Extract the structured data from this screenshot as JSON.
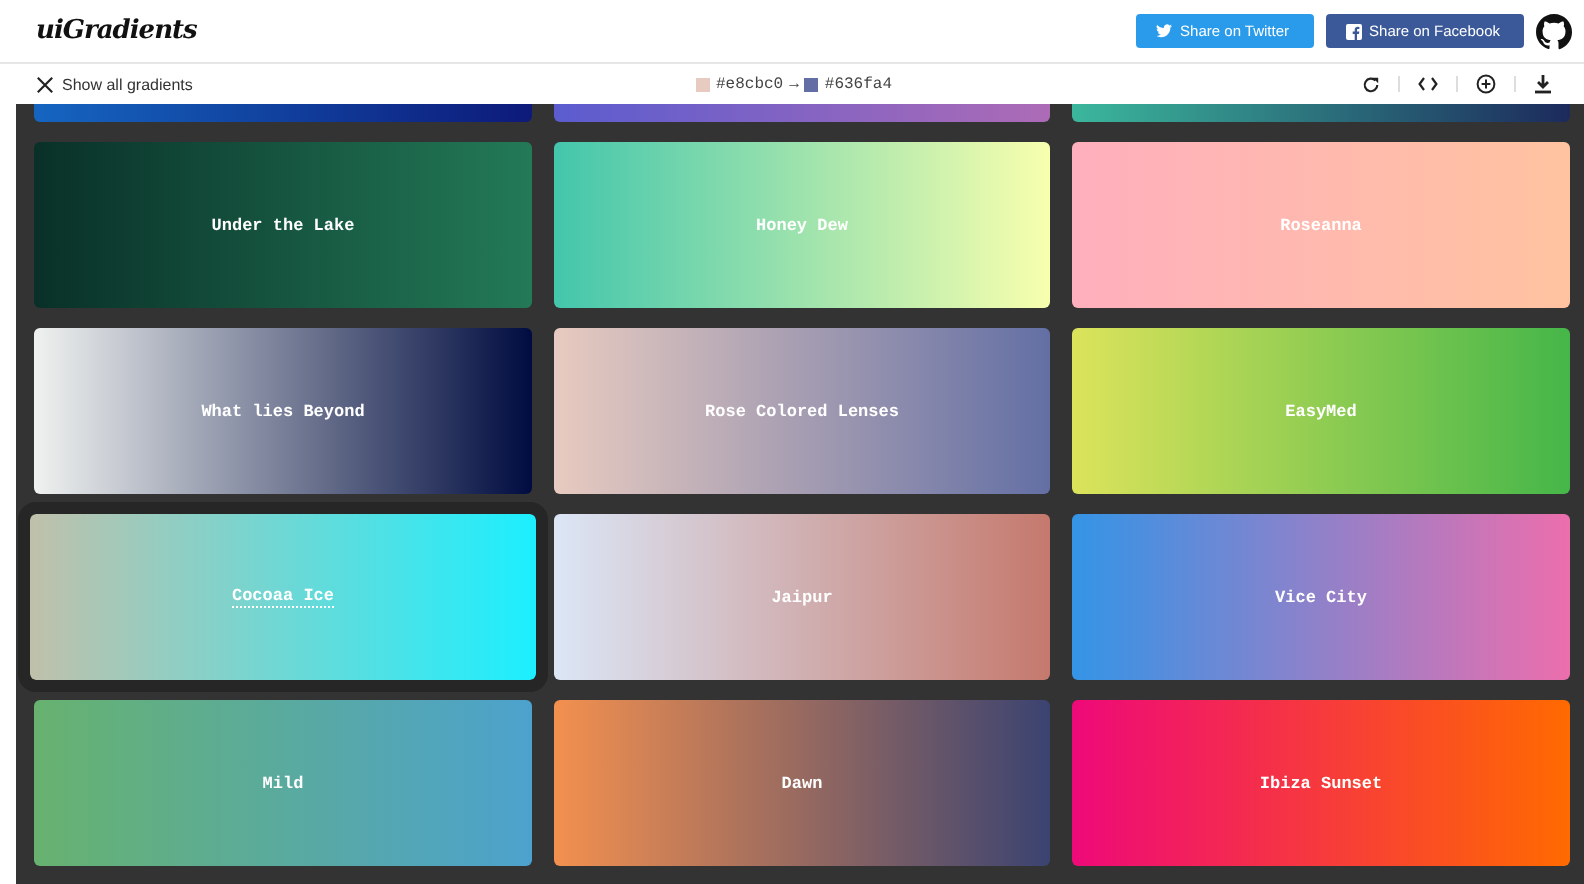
{
  "header": {
    "logo": "uiGradients",
    "buttons": [
      {
        "kind": "twitter",
        "label": "Share on Twitter"
      },
      {
        "kind": "facebook",
        "label": "Share on Facebook"
      }
    ]
  },
  "toolbar": {
    "back": "Show all gradients",
    "from": "#e8cbc0",
    "arrow": "→",
    "to": "#636fa4"
  },
  "cards": [
    {
      "cut": true,
      "stops": [
        {
          "color": "#1565c0"
        },
        {
          "color": "#0d1a7a"
        }
      ],
      "selected": false
    },
    {
      "cut": true,
      "stops": [
        {
          "color": "#5b5ccf"
        },
        {
          "color": "#ad6bb6"
        }
      ],
      "selected": false
    },
    {
      "cut": true,
      "stops": [
        {
          "color": "#3bb79c"
        },
        {
          "color": "#1c2a5c"
        }
      ],
      "selected": false
    },
    {
      "name": "Under the Lake",
      "stops": [
        {
          "color": "#093028"
        },
        {
          "color": "#237a57"
        }
      ],
      "selected": false
    },
    {
      "name": "Honey Dew",
      "stops": [
        {
          "color": "#43c6ac"
        },
        {
          "color": "#f8ffae"
        }
      ],
      "selected": false
    },
    {
      "name": "Roseanna",
      "stops": [
        {
          "color": "#ffafbd"
        },
        {
          "color": "#ffc3a0"
        }
      ],
      "selected": false
    },
    {
      "name": "What lies Beyond",
      "stops": [
        {
          "color": "#f0f2f0"
        },
        {
          "color": "#000c40"
        }
      ],
      "selected": false
    },
    {
      "name": "Rose Colored Lenses",
      "stops": [
        {
          "color": "#e8cbc0"
        },
        {
          "color": "#636fa4"
        }
      ],
      "selected": false
    },
    {
      "name": "EasyMed",
      "stops": [
        {
          "color": "#dce35b"
        },
        {
          "color": "#45b649"
        }
      ],
      "selected": false
    },
    {
      "name": "Cocoaa Ice",
      "stops": [
        {
          "color": "#c0c0aa"
        },
        {
          "color": "#1cefff"
        }
      ],
      "selected": true
    },
    {
      "name": "Jaipur",
      "stops": [
        {
          "color": "#dbe6f6"
        },
        {
          "color": "#c5796d"
        }
      ],
      "selected": false
    },
    {
      "name": "Vice City",
      "stops": [
        {
          "color": "#3494e6"
        },
        {
          "color": "#ec6ead"
        }
      ],
      "selected": false
    },
    {
      "name": "Mild",
      "stops": [
        {
          "color": "#67b26f"
        },
        {
          "color": "#4ca2cd"
        }
      ],
      "selected": false
    },
    {
      "name": "Dawn",
      "stops": [
        {
          "color": "#f3904f"
        },
        {
          "color": "#3b4371"
        }
      ],
      "selected": false
    },
    {
      "name": "Ibiza Sunset",
      "stops": [
        {
          "color": "#ee0979"
        },
        {
          "color": "#ff6a00"
        }
      ],
      "selected": false
    }
  ]
}
